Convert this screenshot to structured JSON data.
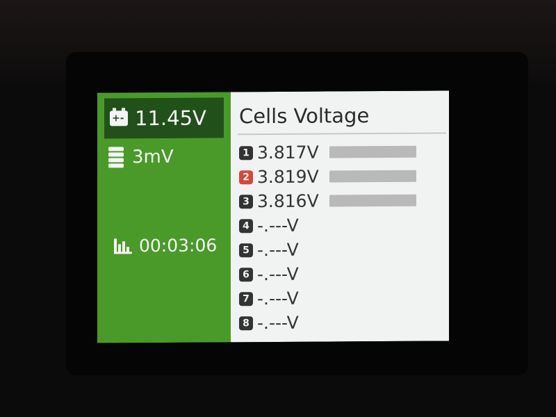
{
  "colors": {
    "sidebar_bg": "#4a9a2a",
    "sidebar_header_bg": "#22501a",
    "panel_bg": "#f1f2f2",
    "badge_default": "#333333",
    "badge_highlight": "#d14a3c",
    "bar": "#b9b9b9"
  },
  "status": {
    "pack_voltage": "11.45V",
    "cell_difference": "3mV",
    "elapsed_time": "00:03:06",
    "icons": {
      "pack_voltage": "battery-icon",
      "cell_difference": "battery-stack-icon",
      "elapsed_time": "bar-chart-icon"
    }
  },
  "panel": {
    "title": "Cells Voltage",
    "cells": [
      {
        "index": "1",
        "voltage": "3.817V",
        "level": 0.95,
        "highlight": false
      },
      {
        "index": "2",
        "voltage": "3.819V",
        "level": 0.95,
        "highlight": true
      },
      {
        "index": "3",
        "voltage": "3.816V",
        "level": 0.95,
        "highlight": false
      },
      {
        "index": "4",
        "voltage": "-.---V",
        "level": 0,
        "highlight": false
      },
      {
        "index": "5",
        "voltage": "-.---V",
        "level": 0,
        "highlight": false
      },
      {
        "index": "6",
        "voltage": "-.---V",
        "level": 0,
        "highlight": false
      },
      {
        "index": "7",
        "voltage": "-.---V",
        "level": 0,
        "highlight": false
      },
      {
        "index": "8",
        "voltage": "-.---V",
        "level": 0,
        "highlight": false
      }
    ]
  }
}
